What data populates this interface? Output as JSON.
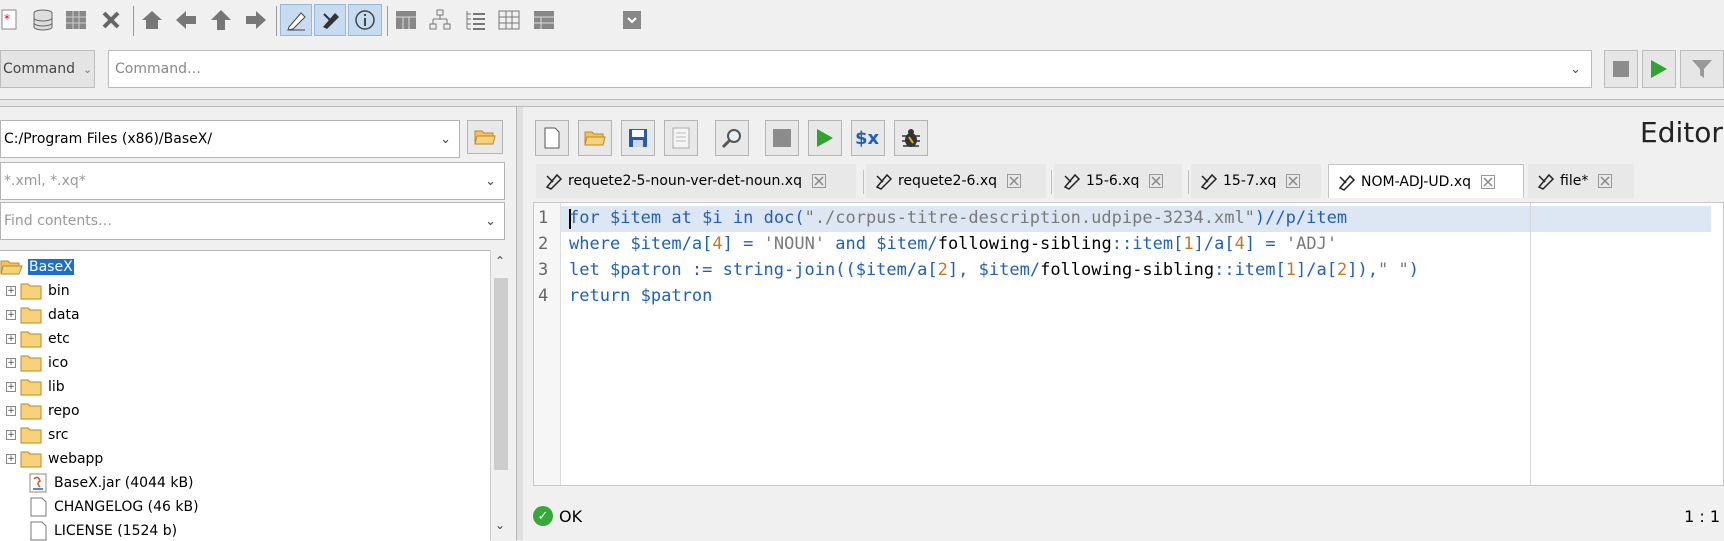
{
  "toolbar": {
    "buttons": [
      "new-database",
      "open-database",
      "properties",
      "close-database",
      "home",
      "back",
      "up",
      "forward",
      "edit",
      "xpath",
      "info",
      "map-view",
      "tree-view",
      "folder-view",
      "table-view",
      "explorer-view",
      "more"
    ]
  },
  "command": {
    "mode": "Command",
    "placeholder": "Command…"
  },
  "files": {
    "path": "C:/Program Files (x86)/BaseX/",
    "filter_placeholder": "*.xml, *.xq*",
    "find_placeholder": "Find contents…",
    "tree": [
      {
        "label": "BaseX",
        "type": "root"
      },
      {
        "label": "bin",
        "type": "folder"
      },
      {
        "label": "data",
        "type": "folder"
      },
      {
        "label": "etc",
        "type": "folder"
      },
      {
        "label": "ico",
        "type": "folder"
      },
      {
        "label": "lib",
        "type": "folder"
      },
      {
        "label": "repo",
        "type": "folder"
      },
      {
        "label": "src",
        "type": "folder"
      },
      {
        "label": "webapp",
        "type": "folder"
      },
      {
        "label": "BaseX.jar (4044 kB)",
        "type": "jar"
      },
      {
        "label": "CHANGELOG (46 kB)",
        "type": "file"
      },
      {
        "label": "LICENSE (1524 b)",
        "type": "file"
      }
    ]
  },
  "editor": {
    "title": "Editor",
    "tabs": [
      {
        "label": "requete2-5-noun-ver-det-noun.xq",
        "active": false
      },
      {
        "label": "requete2-6.xq",
        "active": false
      },
      {
        "label": "15-6.xq",
        "active": false
      },
      {
        "label": "15-7.xq",
        "active": false
      },
      {
        "label": "NOM-ADJ-UD.xq",
        "active": true
      },
      {
        "label": "file*",
        "active": false
      }
    ],
    "lines": [
      {
        "num": "1",
        "text": "for $item at $i in doc(\"./corpus-titre-description.udpipe-3234.xml\")//p/item"
      },
      {
        "num": "2",
        "text": "where $item/a[4] = 'NOUN' and $item/following-sibling::item[1]/a[4] = 'ADJ'"
      },
      {
        "num": "3",
        "text": "let $patron := string-join(($item/a[2], $item/following-sibling::item[1]/a[2]),\" \")"
      },
      {
        "num": "4",
        "text": "return $patron"
      }
    ],
    "status": "OK",
    "cursor": "1 : 1"
  },
  "colors": {
    "keyword": "#1f5fbf",
    "string": "#7a7a7a",
    "number": "#c27a2a",
    "selection": "#1e6fc7"
  }
}
